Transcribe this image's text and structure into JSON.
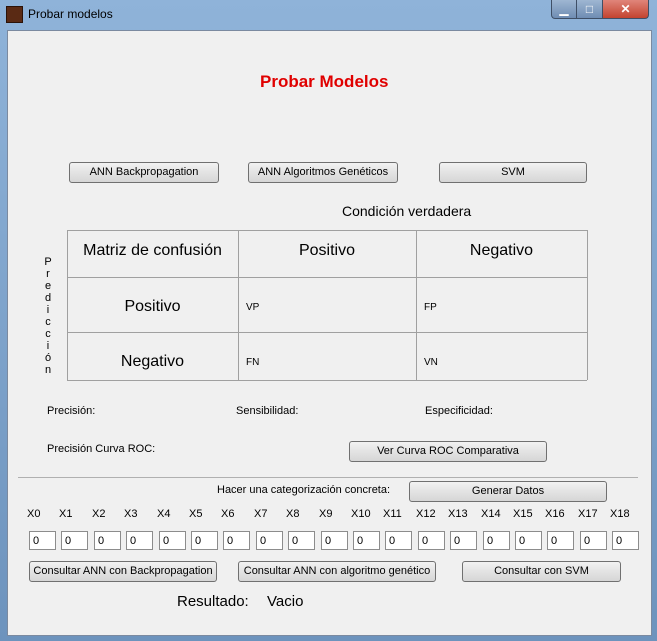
{
  "window": {
    "title": "Probar modelos",
    "min_icon": "minimize-icon",
    "max_icon": "maximize-icon",
    "close_icon": "close-icon"
  },
  "heading": "Probar Modelos",
  "model_buttons": [
    "ANN  Backpropagation",
    "ANN Algoritmos Genéticos",
    "SVM"
  ],
  "matrix": {
    "condition": "Condición verdadera",
    "prediction_letters": [
      "P",
      "r",
      "e",
      "d",
      "i",
      "c",
      "c",
      "i",
      "ó",
      "n"
    ],
    "corner": "Matriz de confusión",
    "col_pos": "Positivo",
    "col_neg": "Negativo",
    "row_pos": "Positivo",
    "row_neg": "Negativo",
    "vp": "VP",
    "fp": "FP",
    "fn": "FN",
    "vn": "VN"
  },
  "metrics": {
    "precision": "Precisión:",
    "sensitivity": "Sensibilidad:",
    "specificity": "Especificidad:",
    "roc_precision": "Precisión Curva ROC:",
    "roc_button": "Ver Curva ROC Comparativa"
  },
  "categorize": {
    "label": "Hacer una categorización concreta:",
    "generate_button": "Generar Datos",
    "inputs": [
      {
        "label": "X0",
        "value": "0"
      },
      {
        "label": "X1",
        "value": "0"
      },
      {
        "label": "X2",
        "value": "0"
      },
      {
        "label": "X3",
        "value": "0"
      },
      {
        "label": "X4",
        "value": "0"
      },
      {
        "label": "X5",
        "value": "0"
      },
      {
        "label": "X6",
        "value": "0"
      },
      {
        "label": "X7",
        "value": "0"
      },
      {
        "label": "X8",
        "value": "0"
      },
      {
        "label": "X9",
        "value": "0"
      },
      {
        "label": "X10",
        "value": "0"
      },
      {
        "label": "X11",
        "value": "0"
      },
      {
        "label": "X12",
        "value": "0"
      },
      {
        "label": "X13",
        "value": "0"
      },
      {
        "label": "X14",
        "value": "0"
      },
      {
        "label": "X15",
        "value": "0"
      },
      {
        "label": "X16",
        "value": "0"
      },
      {
        "label": "X17",
        "value": "0"
      },
      {
        "label": "X18",
        "value": "0"
      }
    ],
    "consult_bp": "Consultar ANN con Backpropagation",
    "consult_ga": "Consultar ANN con algoritmo genético",
    "consult_svm": "Consultar con SVM"
  },
  "result": {
    "label": "Resultado:",
    "value": "Vacio"
  }
}
